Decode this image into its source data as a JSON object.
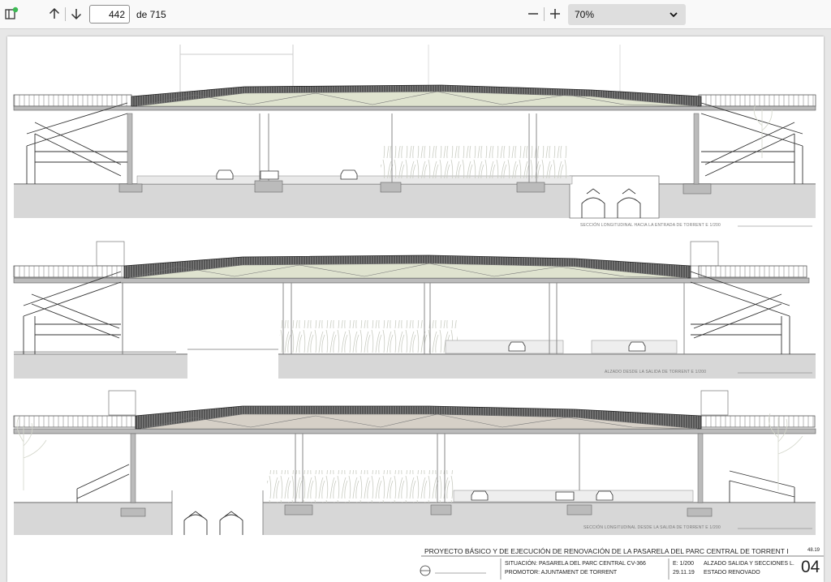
{
  "toolbar": {
    "current_page": "442",
    "total_pages_label": "de 715",
    "zoom": "70%"
  },
  "sheet": {
    "captions": [
      "SECCIÓN LONGITUDINAL HACIA LA ENTRADA DE TORRENT   E 1/200",
      "ALZADO DESDE LA SALIDA DE TORRENT   E 1/200",
      "SECCIÓN LONGITUDINAL DESDE LA SALIDA DE TORRENT   E 1/200"
    ],
    "title_block": {
      "title": "PROYECTO BÁSICO Y DE EJECUCIÓN DE RENOVACIÓN DE LA PASARELA DEL PARC CENTRAL DE TORRENT I",
      "code": "48.19",
      "situacion": "SITUACIÓN: PASARELA DEL PARC CENTRAL CV-366",
      "promotor": "PROMOTOR: AJUNTAMENT DE TORRENT",
      "escala": "E: 1/200",
      "fecha": "29.11.19",
      "descripcion": "ALZADO SALIDA Y SECCIONES L.",
      "estado": "ESTADO RENOVADO",
      "sheet_number": "04"
    }
  }
}
